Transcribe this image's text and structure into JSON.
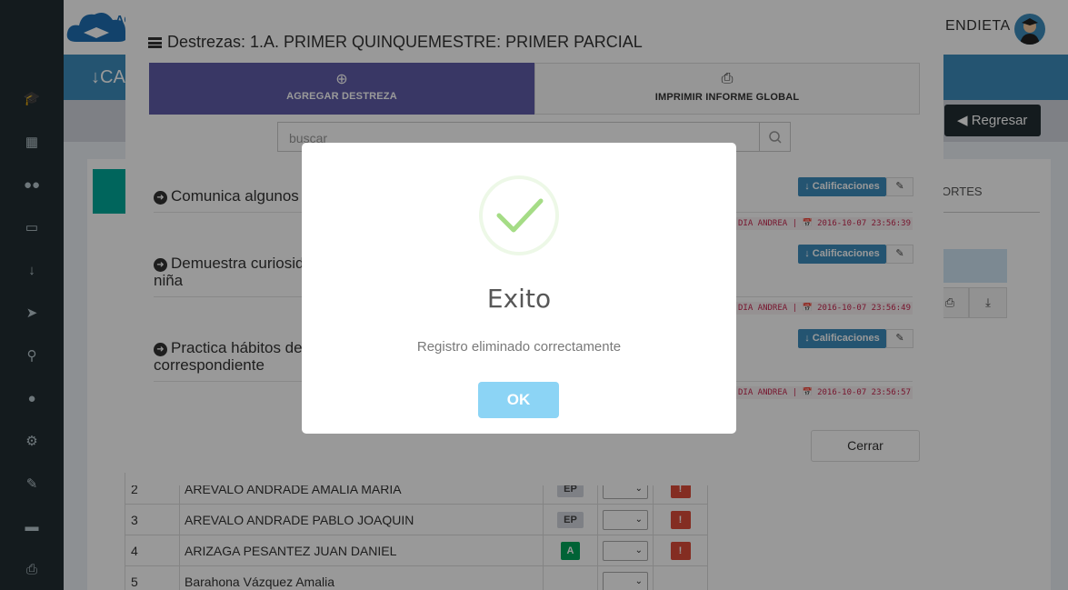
{
  "app": {
    "user_name": "ENDIETA",
    "logo_text": "AC",
    "page_header_icon": "sort-numeric-icon",
    "page_header_text": "CA",
    "back_button": "Regresar"
  },
  "sidebar_icons": [
    "graduation-cap-icon",
    "calendar-icon",
    "users-icon",
    "money-icon",
    "sort-numeric-icon",
    "paper-plane-icon",
    "bicycle-icon",
    "user-icon",
    "gears-icon",
    "paint-brush-icon",
    "car-icon",
    "print-icon"
  ],
  "right_panel": {
    "tab_label": "ORTES"
  },
  "students": [
    {
      "num": "2",
      "name": "AREVALO ANDRADE AMALIA MARIA",
      "grade": "EP",
      "action": "!"
    },
    {
      "num": "3",
      "name": "AREVALO ANDRADE PABLO JOAQUIN",
      "grade": "EP",
      "action": "!"
    },
    {
      "num": "4",
      "name": "ARIZAGA PESANTEZ JUAN DANIEL",
      "grade": "A",
      "action": "!"
    },
    {
      "num": "5",
      "name": "Barahona Vázquez Amalia",
      "grade": "",
      "action": ""
    }
  ],
  "skills_modal": {
    "title": "Destrezas: 1.A. PRIMER QUINQUEMESTRE: PRIMER PARCIAL",
    "add_button": "AGREGAR DESTREZA",
    "print_button": "IMPRIMIR INFORME GLOBAL",
    "search_placeholder": "buscar",
    "skills": [
      {
        "line1": "Comunica algunos",
        "line2": "",
        "calif": "Calificaciones",
        "meta": "DIA ANDREA | 📅 2016-10-07 23:56:39"
      },
      {
        "line1": "Demuestra curiosid",
        "line2": "niña",
        "calif": "Calificaciones",
        "meta": "DIA ANDREA | 📅 2016-10-07 23:56:49"
      },
      {
        "line1": "Practica hábitos de",
        "line2": "correspondiente",
        "calif": "Calificaciones",
        "meta": "DIA ANDREA | 📅 2016-10-07 23:56:57"
      }
    ],
    "close_button": "Cerrar"
  },
  "alert": {
    "icon": "success-check-icon",
    "title": "Exito",
    "text": "Registro eliminado correctamente",
    "ok_button": "OK",
    "success_color": "#a5dc86",
    "ok_color": "#8cd4f5"
  }
}
